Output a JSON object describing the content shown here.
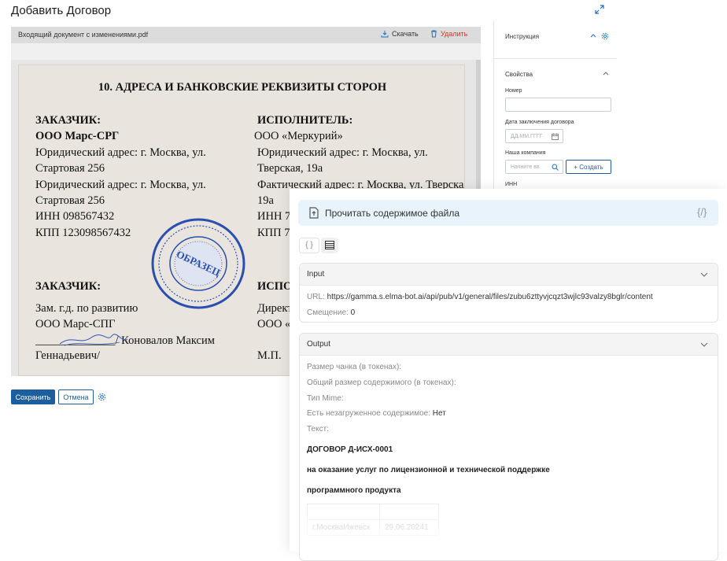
{
  "dialog": {
    "title": "Добавить Договор"
  },
  "viewer": {
    "file_name": "Входящий документ с изменениями.pdf",
    "download_label": "Скачать",
    "delete_label": "Удалить",
    "doc": {
      "heading": "10. АДРЕСА И БАНКОВСКИЕ РЕКВИЗИТЫ СТОРОН",
      "left": {
        "role": "ЗАКАЗЧИК:",
        "company": "ООО Марс-СРГ",
        "line1": "Юридический адрес: г. Москва, ул.",
        "line2": "Стартовая 256",
        "line3": "Юридический адрес: г. Москва, ул.",
        "line4": "Стартовая 256",
        "inn": "ИНН 098567432",
        "kpp": "КПП 123098567432",
        "role2": "ЗАКАЗЧИК:",
        "position": "Зам. г.д. по развитию",
        "company2": "ООО Марс-СПГ",
        "sign_line": "______________/ Коновалов Максим",
        "patronymic": "Геннадьевич/"
      },
      "right": {
        "role": "ИСПОЛНИТЕЛЬ:",
        "company": "ООО «Меркурий»",
        "line1": "Юридический адрес: г. Москва, ул.",
        "line2": "Тверская, 19а",
        "line3": "Фактический адрес: г. Москва, ул. Тверская",
        "line4": "19а",
        "inn": "ИНН 7",
        "kpp": "КПП 7",
        "role2": "ИСПО",
        "position": "Директ",
        "company2": "ООО «",
        "mp": "М.П."
      },
      "stamp_text": "ОБРАЗЕЦ"
    }
  },
  "actions": {
    "save": "Сохранить",
    "cancel": "Отмена"
  },
  "sidebar": {
    "instruction": "Инструкция",
    "properties": "Свойства",
    "number_label": "Номер",
    "date_label": "Дата заключения договора",
    "date_placeholder": "ДД.ММ.ГГГГ",
    "company_label": "Наша компания",
    "company_placeholder": "Начните вв",
    "create_label": "+ Создать",
    "inn_label": "ИНН"
  },
  "panel": {
    "function_title": "Прочитать содержимое файла",
    "code_glyph": "{/}",
    "tab_json": "{ }",
    "input": {
      "title": "Input",
      "url_label": "URL:",
      "url_value": "https://gamma.s.elma-bot.ai/api/pub/v1/general/files/zubu6zttyvjcqzt3wjlc93valzy8bglr/content",
      "offset_label": "Смещение:",
      "offset_value": "0"
    },
    "output": {
      "title": "Output",
      "chunk_label": "Размер чанка (в токенах):",
      "total_label": "Общий размер содержимого (в токенах):",
      "mime_label": "Тип Mime:",
      "unloaded_label": "Есть незагруженное содержимое:",
      "unloaded_value": "Нет",
      "text_label": "Текст:",
      "text_line1": "ДОГОВОР Д-ИСХ-0001",
      "text_line2": "на оказание услуг по лицензионной и технической поддержке",
      "text_line3": "программного продукта",
      "table_city": "г.МоскваИжевск",
      "table_date": "29.06.20241"
    }
  },
  "colors": {
    "accent": "#1d5f9e",
    "danger": "#d0342c",
    "link": "#1d6fc2",
    "fn_bg": "#e9f3fb"
  }
}
